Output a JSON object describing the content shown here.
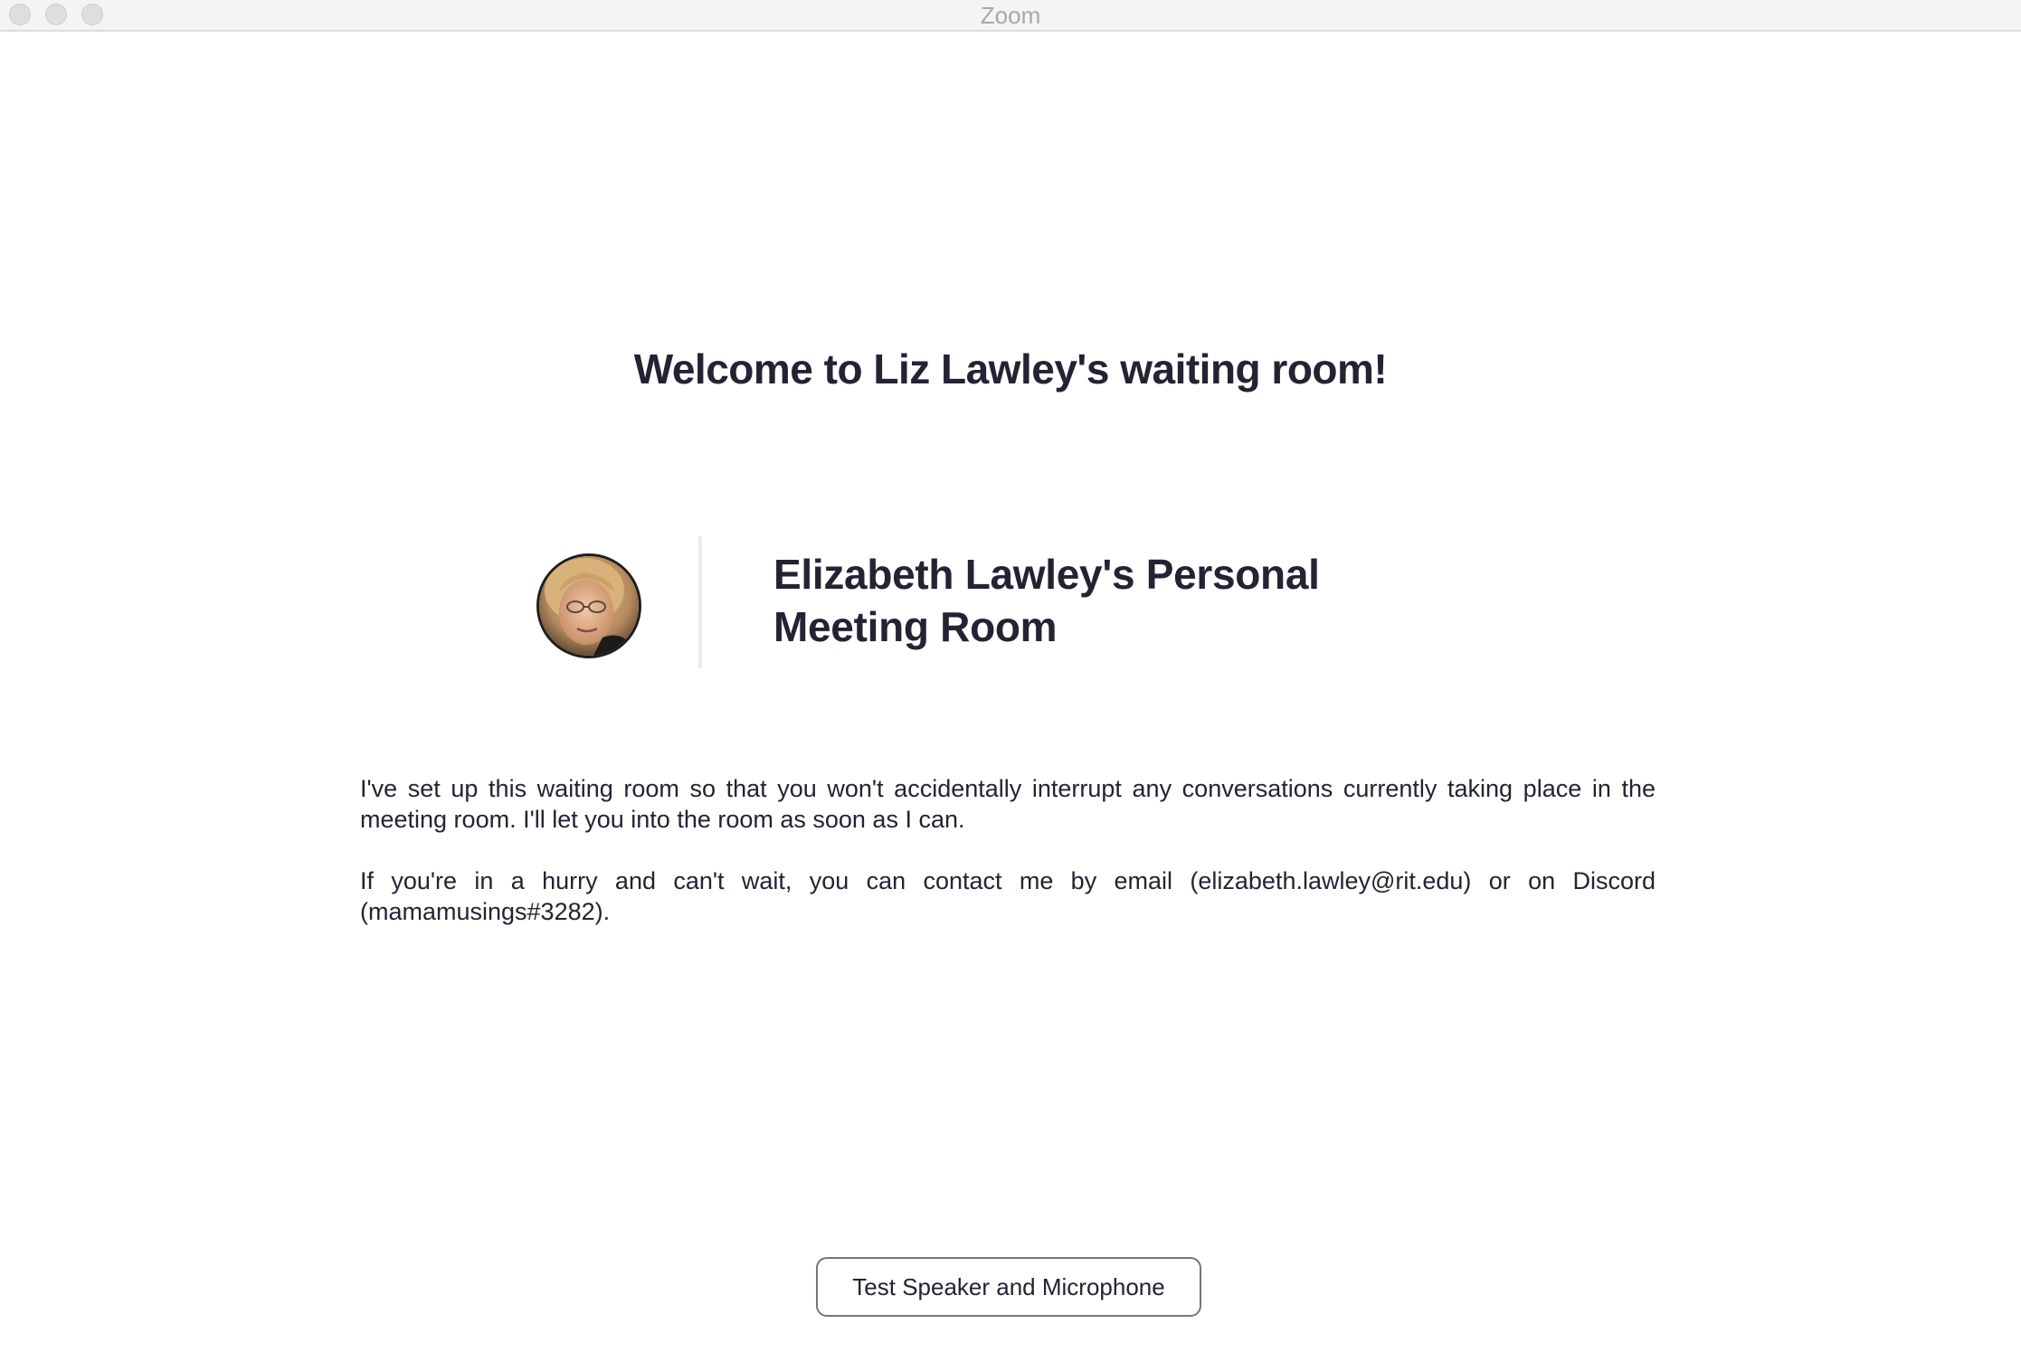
{
  "window": {
    "title": "Zoom"
  },
  "waiting_room": {
    "welcome_heading": "Welcome to Liz Lawley's waiting room!",
    "host_avatar_icon": "profile-photo",
    "meeting_name_line1": "Elizabeth Lawley's Personal",
    "meeting_name_line2": "Meeting Room",
    "message_paragraphs": [
      "I've set up this waiting room so that you won't accidentally interrupt any conversations currently taking place in the meeting room. I'll let you into the room as soon as I can.",
      "If you're in a hurry and can't wait, you can contact me by email (elizabeth.lawley@rit.edu) or on Discord (mamamusings#3282)."
    ]
  },
  "actions": {
    "test_audio_label": "Test Speaker and Microphone"
  },
  "colors": {
    "text": "#232333",
    "title_text": "#a8a8a8",
    "button_border": "#6e7680",
    "divider": "#ececee"
  }
}
